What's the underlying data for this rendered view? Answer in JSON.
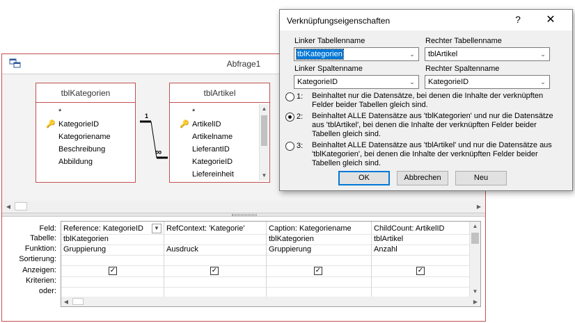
{
  "query": {
    "title": "Abfrage1",
    "tables": [
      {
        "name": "tblKategorien",
        "fields": [
          "*",
          "KategorieID",
          "Kategoriename",
          "Beschreibung",
          "Abbildung"
        ],
        "key_field_index": 1
      },
      {
        "name": "tblArtikel",
        "fields": [
          "*",
          "ArtikelID",
          "Artikelname",
          "LieferantID",
          "KategorieID",
          "Liefereinheit"
        ],
        "key_field_index": 1
      }
    ],
    "relation": {
      "one_label": "1",
      "many_label": "∞"
    },
    "grid": {
      "row_labels": [
        "Feld:",
        "Tabelle:",
        "Funktion:",
        "Sortierung:",
        "Anzeigen:",
        "Kriterien:",
        "oder:"
      ],
      "columns": [
        {
          "feld": "Reference: KategorieID",
          "tabelle": "tblKategorien",
          "funktion": "Gruppierung",
          "anzeigen": true
        },
        {
          "feld": "RefContext: 'Kategorie'",
          "tabelle": "",
          "funktion": "Ausdruck",
          "anzeigen": true
        },
        {
          "feld": "Caption: Kategoriename",
          "tabelle": "tblKategorien",
          "funktion": "Gruppierung",
          "anzeigen": true
        },
        {
          "feld": "ChildCount: ArtikelID",
          "tabelle": "tblArtikel",
          "funktion": "Anzahl",
          "anzeigen": true
        }
      ]
    }
  },
  "dialog": {
    "title": "Verknüpfungseigenschaften",
    "help_label": "?",
    "close_label": "✕",
    "left_table_label": "Linker Tabellenname",
    "left_table_value": "tblKategorien",
    "right_table_label": "Rechter Tabellenname",
    "right_table_value": "tblArtikel",
    "left_column_label": "Linker Spaltenname",
    "left_column_value": "KategorieID",
    "right_column_label": "Rechter Spaltenname",
    "right_column_value": "KategorieID",
    "options": [
      {
        "num": "1:",
        "text": "Beinhaltet nur die Datensätze, bei denen die Inhalte der verknüpften Felder beider Tabellen gleich sind.",
        "selected": false
      },
      {
        "num": "2:",
        "text": "Beinhaltet ALLE Datensätze aus 'tblKategorien' und nur die Datensätze aus 'tblArtikel', bei denen die Inhalte der verknüpften Felder beider Tabellen gleich sind.",
        "selected": true
      },
      {
        "num": "3:",
        "text": "Beinhaltet ALLE Datensätze aus 'tblArtikel' und nur die Datensätze aus 'tblKategorien', bei denen die Inhalte der verknüpften Felder beider Tabellen gleich sind.",
        "selected": false
      }
    ],
    "ok_label": "OK",
    "cancel_label": "Abbrechen",
    "new_label": "Neu"
  },
  "icons": {
    "key": "key-icon",
    "app": "query-icon"
  }
}
